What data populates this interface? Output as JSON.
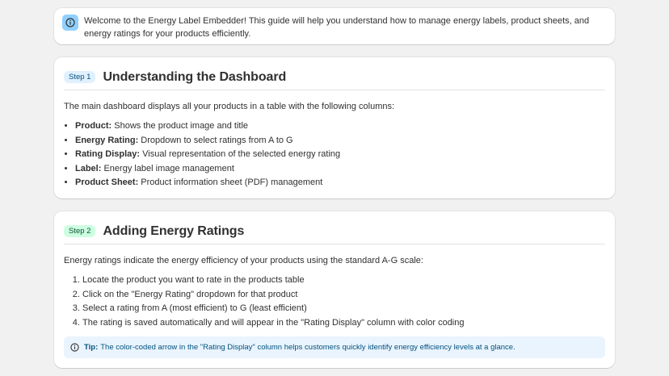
{
  "banner": {
    "icon": "info-icon",
    "text": "Welcome to the Energy Label Embedder! This guide will help you understand how to manage energy labels, product sheets, and energy ratings for your products efficiently."
  },
  "step1": {
    "badge": "Step 1",
    "title": "Understanding the Dashboard",
    "intro": "The main dashboard displays all your products in a table with the following columns:",
    "items": [
      {
        "term": "Product:",
        "desc": " Shows the product image and title"
      },
      {
        "term": "Energy Rating:",
        "desc": " Dropdown to select ratings from A to G"
      },
      {
        "term": "Rating Display:",
        "desc": " Visual representation of the selected energy rating"
      },
      {
        "term": "Label:",
        "desc": " Energy label image management"
      },
      {
        "term": "Product Sheet:",
        "desc": " Product information sheet (PDF) management"
      }
    ]
  },
  "step2": {
    "badge": "Step 2",
    "title": "Adding Energy Ratings",
    "intro": "Energy ratings indicate the energy efficiency of your products using the standard A-G scale:",
    "steps": [
      "Locate the product you want to rate in the products table",
      "Click on the \"Energy Rating\" dropdown for that product",
      "Select a rating from A (most efficient) to G (least efficient)",
      "The rating is saved automatically and will appear in the \"Rating Display\" column with color coding"
    ],
    "tip": {
      "icon": "info-circle-icon",
      "label": "Tip:",
      "text": "The color-coded arrow in the \"Rating Display\" column helps customers quickly identify energy efficiency levels at a glance."
    }
  },
  "colors": {
    "page_bg": "#f1f1f1",
    "card_bg": "#ffffff",
    "banner_icon_bg": "#91d0ff",
    "step1_badge_bg": "#e0f0ff",
    "step2_badge_bg": "#cdfee1",
    "tip_bg": "#eaf4ff"
  }
}
